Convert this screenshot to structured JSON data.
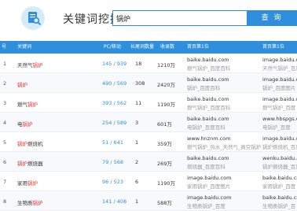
{
  "header": {
    "title": "关键词挖掘",
    "search_value": "锅炉",
    "search_button": "查 询",
    "logo_icon": "search-document-icon"
  },
  "table": {
    "columns": [
      "号",
      "关键词",
      "PC/移动",
      "长尾词数量",
      "收录数",
      "首页第1位",
      "首页第1位"
    ],
    "rows": [
      {
        "idx": "1",
        "kw_pre": "天然气",
        "kw_hl": "锅炉",
        "kw_post": "",
        "pc": "145 / 939",
        "len": "18",
        "cnt": "1210万",
        "r1a": "baike.baidu.com",
        "r1b": "燃气锅炉_百度百科",
        "r2a": "image.baidu.com",
        "r2b": "天然气锅炉_百度"
      },
      {
        "idx": "2",
        "kw_pre": "",
        "kw_hl": "锅炉",
        "kw_post": "",
        "pc": "490 / 569",
        "len": "308",
        "cnt": "2420万",
        "r1a": "baike.baidu.com",
        "r1b": "锅炉_百度百科",
        "r2a": "image.baidu.com",
        "r2b": "锅炉_百度图片"
      },
      {
        "idx": "3",
        "kw_pre": "燃气",
        "kw_hl": "锅炉",
        "kw_post": "",
        "pc": "393 / 562",
        "len": "11",
        "cnt": "1190万",
        "r1a": "baike.baidu.com",
        "r1b": "燃气锅炉_百度百科",
        "r2a": "image.baidu.com",
        "r2b": "燃气锅炉_百度"
      },
      {
        "idx": "4",
        "kw_pre": "电",
        "kw_hl": "锅炉",
        "kw_post": "",
        "pc": "254 / 589",
        "len": "3",
        "cnt": "601万",
        "r1a": "baike.baidu.com",
        "r1b": "电锅炉_百度百科",
        "r2a": "www.hbspgs.com",
        "r2b": "电锅炉_百度"
      },
      {
        "idx": "5",
        "kw_pre": "",
        "kw_hl": "锅炉",
        "kw_post": "燃烧机",
        "pc": "51 / 641",
        "len": "1",
        "cnt": "359万",
        "r1a": "www.hnznm.com",
        "r1b": "燃气锅炉_热水_天然气_真空锅炉",
        "r2a": "image.baidu.com",
        "r2b": "锅炉燃烧机_百度"
      },
      {
        "idx": "6",
        "kw_pre": "",
        "kw_hl": "锅炉",
        "kw_post": "燃烧器",
        "pc": "79 / 568",
        "len": "2",
        "cnt": "269万",
        "r1a": "baike.baidu.com",
        "r1b": "燃烧器_百度百科",
        "r2a": "wenku.baidu.com",
        "r2b": "锅炉燃烧器_百度"
      },
      {
        "idx": "7",
        "kw_pre": "家用",
        "kw_hl": "锅炉",
        "kw_post": "",
        "pc": "96 / 523",
        "len": "6",
        "cnt": "1190万",
        "r1a": "image.baidu.com",
        "r1b": "家用锅炉_百度图片",
        "r2a": "baike.baidu.com",
        "r2b": "家用锅炉_百度"
      },
      {
        "idx": "8",
        "kw_pre": "生物质",
        "kw_hl": "锅炉",
        "kw_post": "",
        "pc": "141 / 408",
        "len": "1",
        "cnt": "588万",
        "r1a": "image.baidu.com",
        "r1b": "生物质锅炉_百度",
        "r2a": "baike.baidu.com",
        "r2b": "生物质锅炉_百"
      }
    ]
  }
}
